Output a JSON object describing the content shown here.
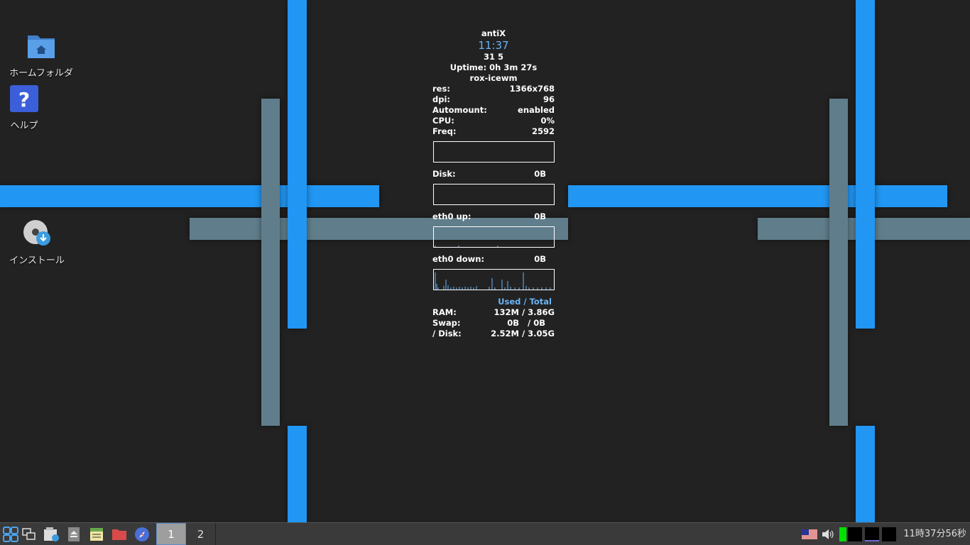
{
  "desktop": {
    "icons": [
      {
        "label": "ホームフォルダ",
        "icon": "home-folder-icon"
      },
      {
        "label": "ヘルプ",
        "icon": "help-icon"
      },
      {
        "label": "インストール",
        "icon": "install-disc-icon"
      }
    ]
  },
  "conky": {
    "host": "antiX",
    "time": "11:37",
    "date": " 31  5",
    "uptime": "Uptime: 0h 3m 27s",
    "wm": "rox-icewm",
    "stats": [
      {
        "label": "res:",
        "value": "1366x768"
      },
      {
        "label": "dpi:",
        "value": "96"
      },
      {
        "label": "Automount:",
        "value": "enabled"
      },
      {
        "label": "CPU:",
        "value": "0%"
      },
      {
        "label": "Freq:",
        "value": "2592"
      }
    ],
    "disk": {
      "label": "Disk:",
      "value": "0B"
    },
    "eth_up": {
      "label": "eth0 up:",
      "value": "0B"
    },
    "eth_down": {
      "label": "eth0 down:",
      "value": "0B"
    },
    "mem_header": "Used / Total",
    "mem": [
      {
        "label": "RAM:",
        "used": "132M",
        "total": "/ 3.86G"
      },
      {
        "label": "Swap:",
        "used": "0B",
        "total": "/ 0B"
      },
      {
        "label": "/ Disk:",
        "used": "2.52M",
        "total": "/ 3.05G"
      }
    ]
  },
  "taskbar": {
    "launchers": [
      "menu-grid-icon",
      "window-list-icon",
      "file-manager-icon",
      "eject-icon",
      "notes-icon",
      "folder-red-icon",
      "browser-compass-icon"
    ],
    "workspaces": [
      "1",
      "2"
    ],
    "active_workspace": "1",
    "tray": {
      "keyboard_layout_icon": "us-flag-icon",
      "volume_icon": "speaker-icon",
      "clock": "11時37分56秒"
    }
  },
  "colors": {
    "background": "#222222",
    "accent_blue": "#2196f3",
    "accent_gray": "#607d8b",
    "conky_highlight": "#6ab4f5"
  }
}
